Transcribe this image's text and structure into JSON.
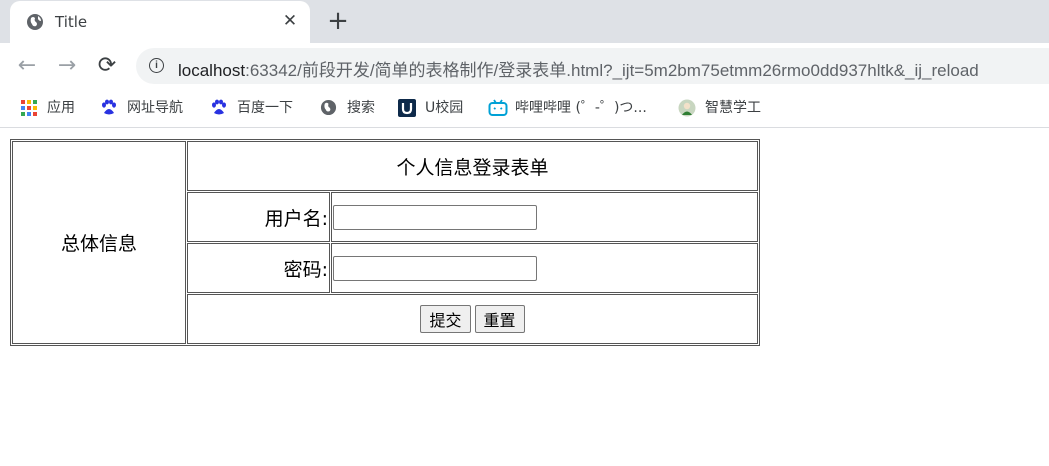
{
  "browser": {
    "tab": {
      "title": "Title",
      "close_glyph": "✕",
      "icon": "globe-icon"
    },
    "new_tab_glyph": "+",
    "nav": {
      "back": "←",
      "forward": "→",
      "reload": "⟳"
    },
    "address": {
      "host": "localhost",
      "path": ":63342/前段开发/简单的表格制作/登录表单.html?_ijt=5m2bm75etmm26rmo0dd937hltk&_ij_reload"
    },
    "bookmarks": [
      {
        "label": "应用",
        "icon": "apps-grid-icon"
      },
      {
        "label": "网址导航",
        "icon": "baidu-paw-icon"
      },
      {
        "label": "百度一下",
        "icon": "baidu-paw-icon"
      },
      {
        "label": "搜索",
        "icon": "globe-icon"
      },
      {
        "label": "U校园",
        "icon": "u-logo-icon"
      },
      {
        "label": "哔哩哔哩 (゜-゜)つ...",
        "icon": "bilibili-tv-icon"
      },
      {
        "label": "智慧学工",
        "icon": "avatar-icon"
      }
    ]
  },
  "form": {
    "side_label": "总体信息",
    "title": "个人信息登录表单",
    "username_label": "用户名:",
    "username_value": "",
    "password_label": "密码:",
    "password_value": "",
    "submit_label": "提交",
    "reset_label": "重置"
  }
}
